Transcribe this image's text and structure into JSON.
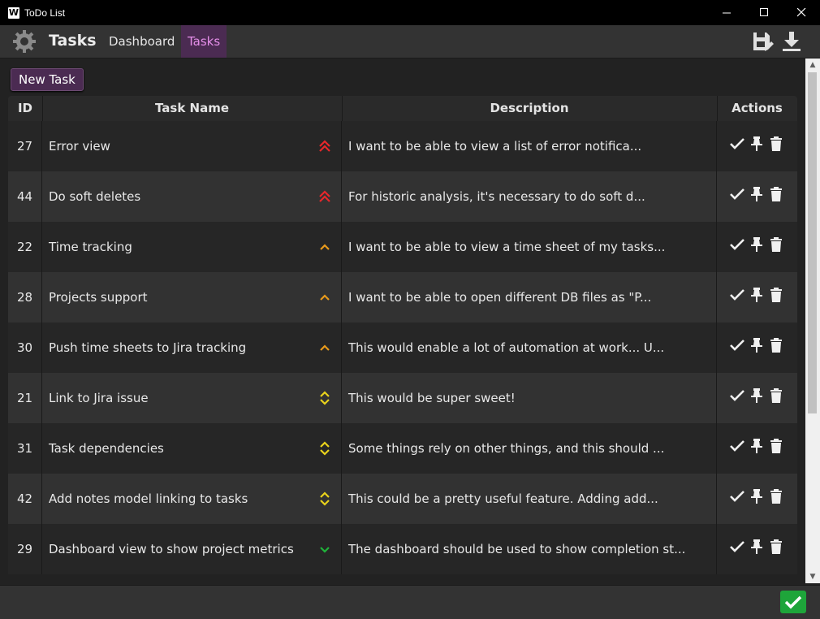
{
  "window": {
    "title": "ToDo List",
    "icon_letter": "W"
  },
  "toolbar": {
    "title": "Tasks",
    "nav": [
      {
        "label": "Dashboard"
      },
      {
        "label": "Tasks",
        "active": true
      }
    ],
    "icons": [
      "gear-icon",
      "save-edit-icon",
      "download-icon"
    ]
  },
  "new_task_label": "New Task",
  "table": {
    "headers": {
      "id": "ID",
      "name": "Task Name",
      "description": "Description",
      "actions": "Actions"
    },
    "rows": [
      {
        "id": "27",
        "name": "Error view",
        "priority": "highest",
        "description": "I want to be able to view a list of error notifica..."
      },
      {
        "id": "44",
        "name": "Do soft deletes",
        "priority": "highest",
        "description": "For historic analysis, it's necessary to do soft d..."
      },
      {
        "id": "22",
        "name": "Time tracking",
        "priority": "high",
        "description": "I want to be able to view a time sheet of my tasks..."
      },
      {
        "id": "28",
        "name": "Projects support",
        "priority": "high",
        "description": "I want to be able to open different DB files as \"P..."
      },
      {
        "id": "30",
        "name": "Push time sheets to Jira tracking",
        "priority": "high",
        "description": "This would enable a lot of automation at work... U..."
      },
      {
        "id": "21",
        "name": "Link to Jira issue",
        "priority": "medium",
        "description": "This would be super sweet!"
      },
      {
        "id": "31",
        "name": "Task dependencies",
        "priority": "medium",
        "description": "Some things rely on other things, and this should ..."
      },
      {
        "id": "42",
        "name": "Add notes model linking to tasks",
        "priority": "medium",
        "description": "This could be a pretty useful feature. Adding add..."
      },
      {
        "id": "29",
        "name": "Dashboard view to show project metrics",
        "priority": "low",
        "description": "The dashboard should be used to show completion st..."
      }
    ]
  },
  "colors": {
    "accent": "#4b2b52",
    "accent_text": "#e48ee8",
    "highest": "#e8272b",
    "high": "#e89a1c",
    "medium": "#e8d21c",
    "low": "#1fb43a",
    "ok": "#1ea53a"
  }
}
